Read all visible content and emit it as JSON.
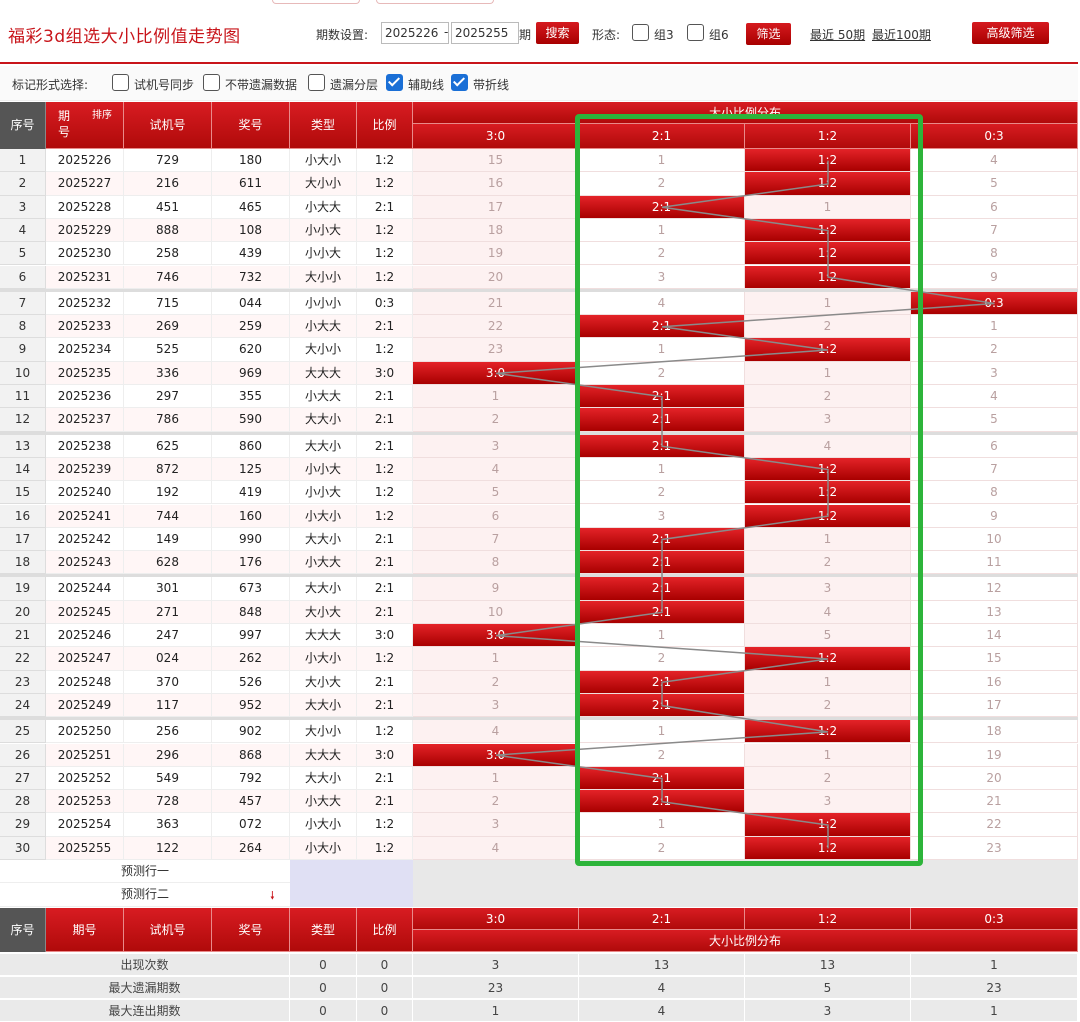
{
  "header": {
    "title": "福彩3d组选大小比例值走势图",
    "period_label": "期数设置:",
    "period_from": "2025226",
    "period_to": "2025255",
    "period_unit": "期",
    "search_label": "搜索",
    "form_label": "形态:",
    "form_opt_zu3": "组3",
    "form_opt_zu6": "组6",
    "filter_label": "筛选",
    "recent50_label": "最近 50期",
    "recent100_label": "最近100期",
    "advanced_label": "高级筛选"
  },
  "options": {
    "label": "标记形式选择:",
    "items": [
      {
        "label": "试机号同步",
        "checked": false
      },
      {
        "label": "不带遗漏数据",
        "checked": false
      },
      {
        "label": "遗漏分层",
        "checked": false
      },
      {
        "label": "辅助线",
        "checked": true
      },
      {
        "label": "带折线",
        "checked": true
      }
    ]
  },
  "table": {
    "col_seq": "序号",
    "col_period": "期号",
    "sort_label": "排序",
    "col_trial": "试机号",
    "col_prize": "奖号",
    "col_type": "类型",
    "col_ratio": "比例",
    "dist_title": "大小比例分布",
    "dist_cols": [
      "3:0",
      "2:1",
      "1:2",
      "0:3"
    ],
    "rows": [
      {
        "seq": "1",
        "period": "2025226",
        "trial": "729",
        "prize": "180",
        "type": "小大小",
        "ratio": "1:2",
        "hit": 2,
        "miss": [
          "15",
          "1",
          "1:2",
          "4"
        ]
      },
      {
        "seq": "2",
        "period": "2025227",
        "trial": "216",
        "prize": "611",
        "type": "大小小",
        "ratio": "1:2",
        "hit": 2,
        "miss": [
          "16",
          "2",
          "1:2",
          "5"
        ]
      },
      {
        "seq": "3",
        "period": "2025228",
        "trial": "451",
        "prize": "465",
        "type": "小大大",
        "ratio": "2:1",
        "hit": 1,
        "miss": [
          "17",
          "2:1",
          "1",
          "6"
        ]
      },
      {
        "seq": "4",
        "period": "2025229",
        "trial": "888",
        "prize": "108",
        "type": "小小大",
        "ratio": "1:2",
        "hit": 2,
        "miss": [
          "18",
          "1",
          "1:2",
          "7"
        ]
      },
      {
        "seq": "5",
        "period": "2025230",
        "trial": "258",
        "prize": "439",
        "type": "小小大",
        "ratio": "1:2",
        "hit": 2,
        "miss": [
          "19",
          "2",
          "1:2",
          "8"
        ]
      },
      {
        "seq": "6",
        "period": "2025231",
        "trial": "746",
        "prize": "732",
        "type": "大小小",
        "ratio": "1:2",
        "hit": 2,
        "miss": [
          "20",
          "3",
          "1:2",
          "9"
        ]
      },
      {
        "seq": "7",
        "period": "2025232",
        "trial": "715",
        "prize": "044",
        "type": "小小小",
        "ratio": "0:3",
        "hit": 3,
        "miss": [
          "21",
          "4",
          "1",
          "0:3"
        ]
      },
      {
        "seq": "8",
        "period": "2025233",
        "trial": "269",
        "prize": "259",
        "type": "小大大",
        "ratio": "2:1",
        "hit": 1,
        "miss": [
          "22",
          "2:1",
          "2",
          "1"
        ]
      },
      {
        "seq": "9",
        "period": "2025234",
        "trial": "525",
        "prize": "620",
        "type": "大小小",
        "ratio": "1:2",
        "hit": 2,
        "miss": [
          "23",
          "1",
          "1:2",
          "2"
        ]
      },
      {
        "seq": "10",
        "period": "2025235",
        "trial": "336",
        "prize": "969",
        "type": "大大大",
        "ratio": "3:0",
        "hit": 0,
        "miss": [
          "3:0",
          "2",
          "1",
          "3"
        ]
      },
      {
        "seq": "11",
        "period": "2025236",
        "trial": "297",
        "prize": "355",
        "type": "小大大",
        "ratio": "2:1",
        "hit": 1,
        "miss": [
          "1",
          "2:1",
          "2",
          "4"
        ]
      },
      {
        "seq": "12",
        "period": "2025237",
        "trial": "786",
        "prize": "590",
        "type": "大大小",
        "ratio": "2:1",
        "hit": 1,
        "miss": [
          "2",
          "2:1",
          "3",
          "5"
        ]
      },
      {
        "seq": "13",
        "period": "2025238",
        "trial": "625",
        "prize": "860",
        "type": "大大小",
        "ratio": "2:1",
        "hit": 1,
        "miss": [
          "3",
          "2:1",
          "4",
          "6"
        ]
      },
      {
        "seq": "14",
        "period": "2025239",
        "trial": "872",
        "prize": "125",
        "type": "小小大",
        "ratio": "1:2",
        "hit": 2,
        "miss": [
          "4",
          "1",
          "1:2",
          "7"
        ]
      },
      {
        "seq": "15",
        "period": "2025240",
        "trial": "192",
        "prize": "419",
        "type": "小小大",
        "ratio": "1:2",
        "hit": 2,
        "miss": [
          "5",
          "2",
          "1:2",
          "8"
        ]
      },
      {
        "seq": "16",
        "period": "2025241",
        "trial": "744",
        "prize": "160",
        "type": "小大小",
        "ratio": "1:2",
        "hit": 2,
        "miss": [
          "6",
          "3",
          "1:2",
          "9"
        ]
      },
      {
        "seq": "17",
        "period": "2025242",
        "trial": "149",
        "prize": "990",
        "type": "大大小",
        "ratio": "2:1",
        "hit": 1,
        "miss": [
          "7",
          "2:1",
          "1",
          "10"
        ]
      },
      {
        "seq": "18",
        "period": "2025243",
        "trial": "628",
        "prize": "176",
        "type": "小大大",
        "ratio": "2:1",
        "hit": 1,
        "miss": [
          "8",
          "2:1",
          "2",
          "11"
        ]
      },
      {
        "seq": "19",
        "period": "2025244",
        "trial": "301",
        "prize": "673",
        "type": "大大小",
        "ratio": "2:1",
        "hit": 1,
        "miss": [
          "9",
          "2:1",
          "3",
          "12"
        ]
      },
      {
        "seq": "20",
        "period": "2025245",
        "trial": "271",
        "prize": "848",
        "type": "大小大",
        "ratio": "2:1",
        "hit": 1,
        "miss": [
          "10",
          "2:1",
          "4",
          "13"
        ]
      },
      {
        "seq": "21",
        "period": "2025246",
        "trial": "247",
        "prize": "997",
        "type": "大大大",
        "ratio": "3:0",
        "hit": 0,
        "miss": [
          "3:0",
          "1",
          "5",
          "14"
        ]
      },
      {
        "seq": "22",
        "period": "2025247",
        "trial": "024",
        "prize": "262",
        "type": "小大小",
        "ratio": "1:2",
        "hit": 2,
        "miss": [
          "1",
          "2",
          "1:2",
          "15"
        ]
      },
      {
        "seq": "23",
        "period": "2025248",
        "trial": "370",
        "prize": "526",
        "type": "大小大",
        "ratio": "2:1",
        "hit": 1,
        "miss": [
          "2",
          "2:1",
          "1",
          "16"
        ]
      },
      {
        "seq": "24",
        "period": "2025249",
        "trial": "117",
        "prize": "952",
        "type": "大大小",
        "ratio": "2:1",
        "hit": 1,
        "miss": [
          "3",
          "2:1",
          "2",
          "17"
        ]
      },
      {
        "seq": "25",
        "period": "2025250",
        "trial": "256",
        "prize": "902",
        "type": "大小小",
        "ratio": "1:2",
        "hit": 2,
        "miss": [
          "4",
          "1",
          "1:2",
          "18"
        ]
      },
      {
        "seq": "26",
        "period": "2025251",
        "trial": "296",
        "prize": "868",
        "type": "大大大",
        "ratio": "3:0",
        "hit": 0,
        "miss": [
          "3:0",
          "2",
          "1",
          "19"
        ]
      },
      {
        "seq": "27",
        "period": "2025252",
        "trial": "549",
        "prize": "792",
        "type": "大大小",
        "ratio": "2:1",
        "hit": 1,
        "miss": [
          "1",
          "2:1",
          "2",
          "20"
        ]
      },
      {
        "seq": "28",
        "period": "2025253",
        "trial": "728",
        "prize": "457",
        "type": "小大大",
        "ratio": "2:1",
        "hit": 1,
        "miss": [
          "2",
          "2:1",
          "3",
          "21"
        ]
      },
      {
        "seq": "29",
        "period": "2025254",
        "trial": "363",
        "prize": "072",
        "type": "小大小",
        "ratio": "1:2",
        "hit": 2,
        "miss": [
          "3",
          "1",
          "1:2",
          "22"
        ]
      },
      {
        "seq": "30",
        "period": "2025255",
        "trial": "122",
        "prize": "264",
        "type": "小大小",
        "ratio": "1:2",
        "hit": 2,
        "miss": [
          "4",
          "2",
          "1:2",
          "23"
        ]
      }
    ],
    "predict_row1": "预测行一",
    "predict_row2": "预测行二",
    "stats": [
      {
        "label": "出现次数",
        "type": "0",
        "ratio": "0",
        "vals": [
          "3",
          "13",
          "13",
          "1"
        ]
      },
      {
        "label": "最大遗漏期数",
        "type": "0",
        "ratio": "0",
        "vals": [
          "23",
          "4",
          "5",
          "23"
        ]
      },
      {
        "label": "最大连出期数",
        "type": "0",
        "ratio": "0",
        "vals": [
          "1",
          "4",
          "3",
          "1"
        ]
      }
    ]
  },
  "colors": {
    "brand_red": "#c8141a",
    "highlight_green": "#2db43a"
  }
}
